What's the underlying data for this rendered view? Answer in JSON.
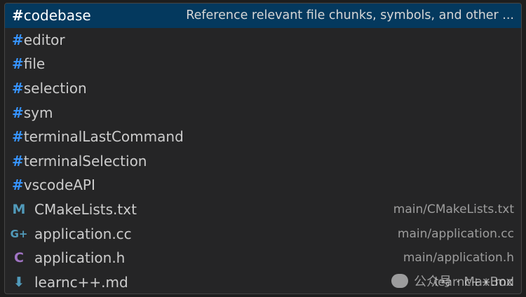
{
  "suggestions": {
    "variables": [
      {
        "hash": "#",
        "name": "codebase",
        "description": "Reference relevant file chunks, symbols, and other ...",
        "selected": true
      },
      {
        "hash": "#",
        "name": "editor"
      },
      {
        "hash": "#",
        "name": "file"
      },
      {
        "hash": "#",
        "name": "selection"
      },
      {
        "hash": "#",
        "name": "sym"
      },
      {
        "hash": "#",
        "name": "terminalLastCommand"
      },
      {
        "hash": "#",
        "name": "terminalSelection"
      },
      {
        "hash": "#",
        "name": "vscodeAPI"
      }
    ],
    "files": [
      {
        "icon": "markdown-m-icon",
        "glyph": "M",
        "color": "#519aba",
        "name": "CMakeLists.txt",
        "path": "main/CMakeLists.txt"
      },
      {
        "icon": "cpp-icon",
        "glyph": "G+",
        "color": "#519aba",
        "name": "application.cc",
        "path": "main/application.cc"
      },
      {
        "icon": "c-header-icon",
        "glyph": "C",
        "color": "#a074c4",
        "name": "application.h",
        "path": "main/application.h"
      },
      {
        "icon": "markdown-arrow-icon",
        "glyph": "⬇",
        "color": "#519aba",
        "name": "learnc++.md",
        "path": "learnc++.md"
      }
    ]
  },
  "watermark": {
    "text": "公众号 · MaxBox"
  }
}
